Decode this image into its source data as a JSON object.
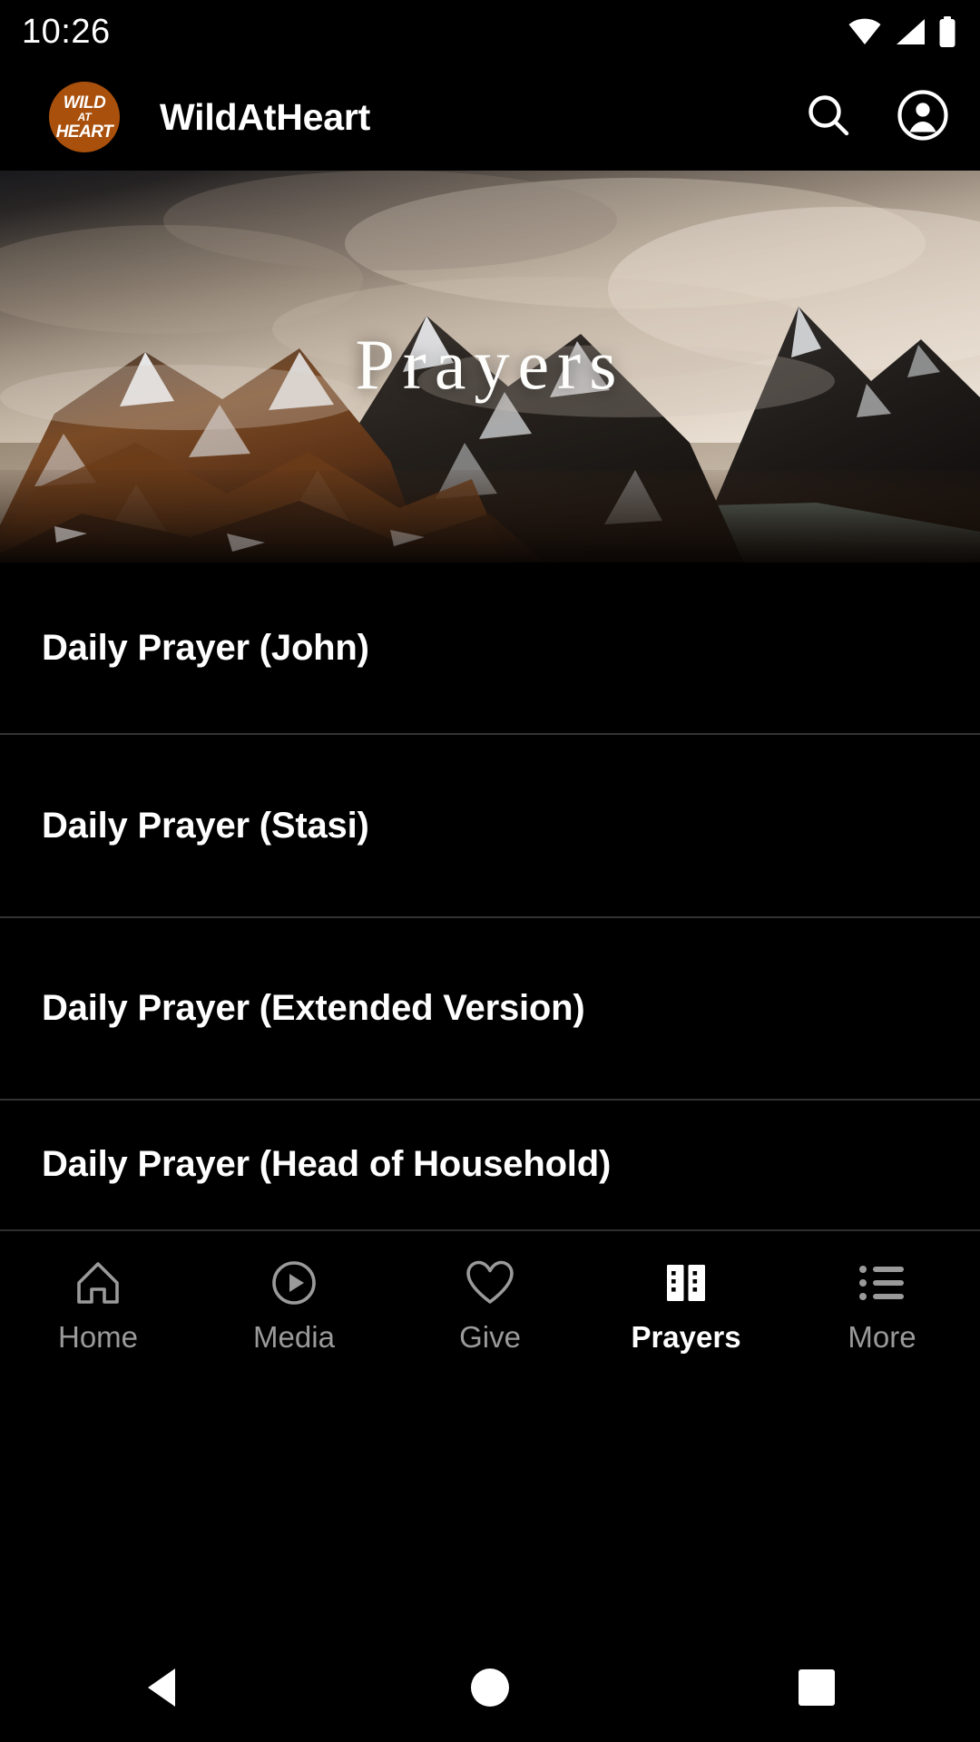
{
  "status_bar": {
    "time": "10:26",
    "icons": [
      "wifi-icon",
      "cellular-signal-icon",
      "battery-icon"
    ]
  },
  "app_bar": {
    "logo": {
      "icon_name": "wildatheart-logo",
      "line1": "WILD",
      "line2": "AT",
      "line3": "HEART",
      "background_color": "#a9500c",
      "text_color": "#ffffff"
    },
    "title": "WildAtHeart",
    "actions": [
      {
        "name": "search-icon",
        "label": "Search"
      },
      {
        "name": "account-circle-icon",
        "label": "Account"
      }
    ]
  },
  "hero": {
    "title": "Prayers",
    "image_alt": "snow-capped dark mountain range under stormy clouds",
    "title_color": "#fdfdfb"
  },
  "prayer_list": {
    "items": [
      {
        "label": "Daily Prayer (John)"
      },
      {
        "label": "Daily Prayer (Stasi)"
      },
      {
        "label": "Daily Prayer (Extended Version)"
      },
      {
        "label": "Daily Prayer (Head of Household)"
      }
    ],
    "divider_color": "#333333"
  },
  "bottom_nav": {
    "active_index": 3,
    "active_color": "#ffffff",
    "inactive_color": "#9a9a9a",
    "items": [
      {
        "label": "Home",
        "icon": "home-icon"
      },
      {
        "label": "Media",
        "icon": "play-circle-icon"
      },
      {
        "label": "Give",
        "icon": "heart-icon"
      },
      {
        "label": "Prayers",
        "icon": "book-icon"
      },
      {
        "label": "More",
        "icon": "list-menu-icon"
      }
    ]
  },
  "system_nav": {
    "items": [
      {
        "name": "android-back-button",
        "label": "Back"
      },
      {
        "name": "android-home-button",
        "label": "Home"
      },
      {
        "name": "android-recents-button",
        "label": "Recents"
      }
    ]
  }
}
